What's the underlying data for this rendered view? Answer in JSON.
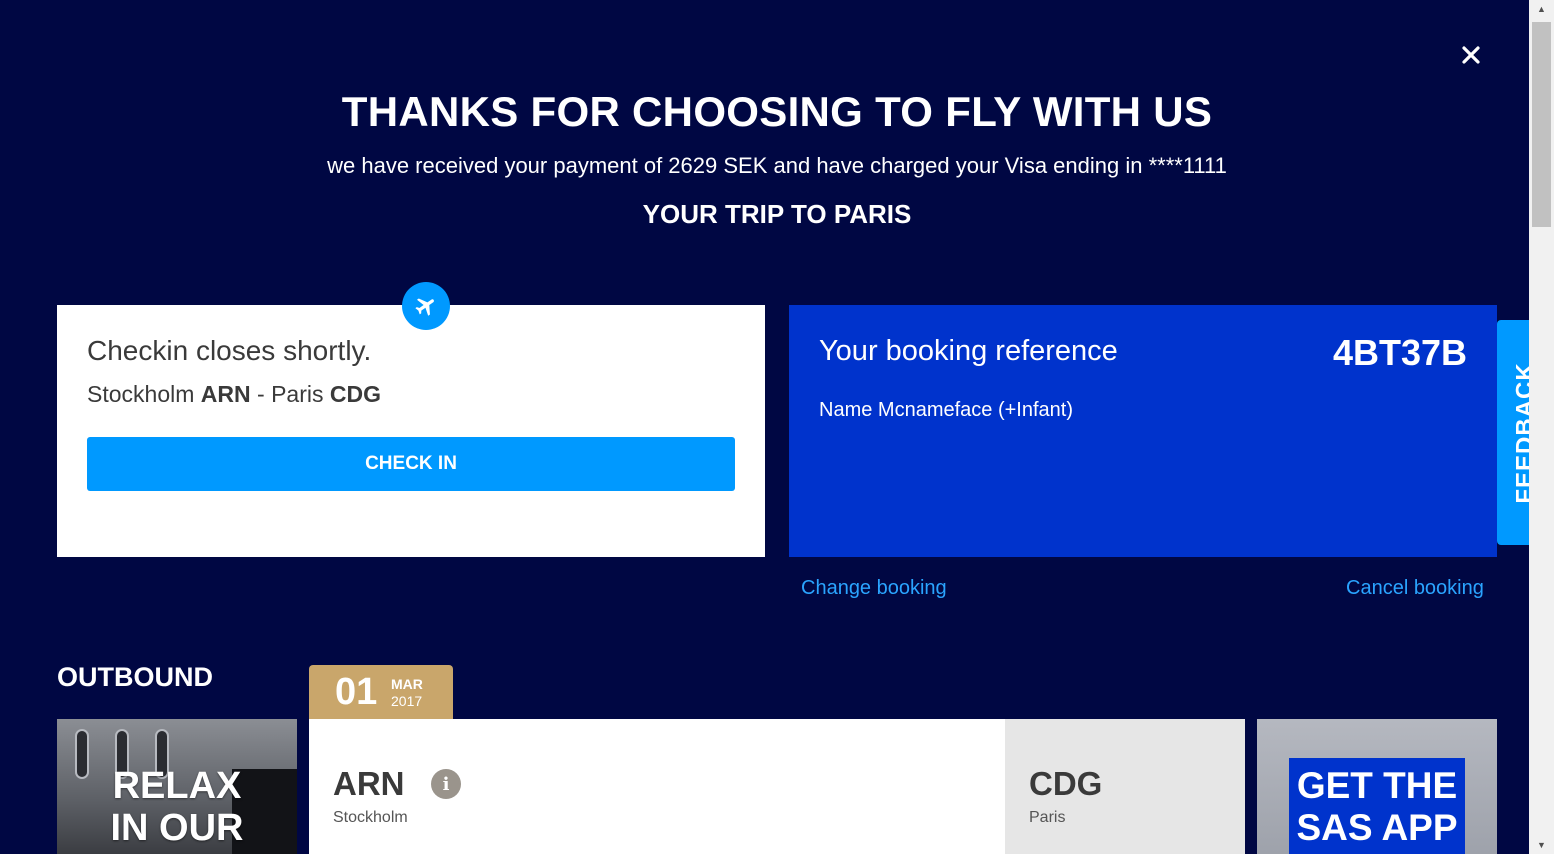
{
  "header": {
    "title": "THANKS FOR CHOOSING TO FLY WITH US",
    "payment_text": "we have received your payment of 2629 SEK and have charged your Visa ending in ****1111",
    "trip_title": "YOUR TRIP TO PARIS",
    "close_icon": "close-icon"
  },
  "checkin": {
    "message": "Checkin closes shortly.",
    "origin_city": "Stockholm",
    "origin_code": "ARN",
    "separator": " - ",
    "dest_city": "Paris",
    "dest_code": "CDG",
    "button_label": "CHECK IN",
    "icon": "airplane-icon"
  },
  "booking": {
    "label": "Your booking reference",
    "reference": "4BT37B",
    "passenger": "Name Mcnameface (+Infant)",
    "change_label": "Change booking",
    "cancel_label": "Cancel booking"
  },
  "feedback": {
    "label": "FEEDBACK"
  },
  "outbound": {
    "label": "OUTBOUND",
    "date_day": "01",
    "date_month": "MAR",
    "date_year": "2017",
    "from_code": "ARN",
    "from_city": "Stockholm",
    "to_code": "CDG",
    "to_city": "Paris",
    "info_icon": "info-icon"
  },
  "promos": {
    "left_line1": "RELAX",
    "left_line2": "IN OUR",
    "right_line1": "GET THE",
    "right_line2": "SAS APP"
  },
  "colors": {
    "background": "#000743",
    "accent_blue": "#0099ff",
    "booking_blue": "#0033cc",
    "date_tab_gold": "#c9a66b",
    "link_blue": "#2aa4ff"
  }
}
